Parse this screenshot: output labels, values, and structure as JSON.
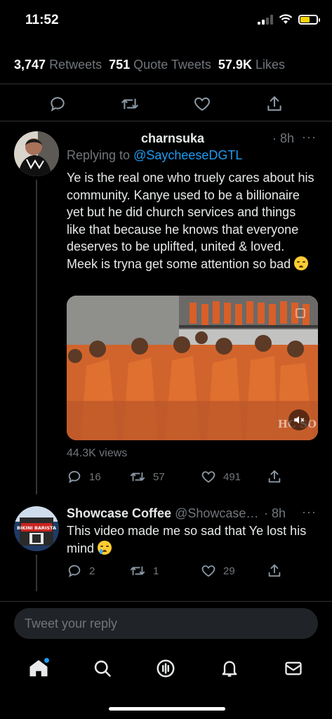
{
  "status_bar": {
    "time": "11:52"
  },
  "stats": {
    "retweets_count": "3,747",
    "retweets_label": "Retweets",
    "quotes_count": "751",
    "quotes_label": "Quote Tweets",
    "likes_count": "57.9K",
    "likes_label": "Likes"
  },
  "replies": [
    {
      "name": "charnsuka",
      "time": "· 8h",
      "more": "···",
      "replying_prefix": "Replying to ",
      "replying_handle": "@SaycheeseDGTL",
      "text": "Ye is the real one who truely cares about his community. Kanye used to be a billionaire yet but he did church services and things like that because he knows that everyone deserves to be uplifted, united & loved. Meek is tryna get some attention so bad",
      "media_watermark": "HC SO",
      "views": "44.3K views",
      "replies": "16",
      "retweets": "57",
      "likes": "491"
    },
    {
      "name": "Showcase Coffee",
      "handle": "@Showcase…",
      "time": "· 8h",
      "more": "···",
      "avatar_text": "BIKINI BARISTA",
      "text": "This video made me so sad that Ye lost his mind",
      "replies": "2",
      "retweets": "1",
      "likes": "29"
    }
  ],
  "compose": {
    "placeholder": "Tweet your reply"
  },
  "colors": {
    "accent": "#1d9bf0",
    "muted": "#71767b",
    "background": "#000000"
  },
  "icons": [
    "reply-icon",
    "retweet-icon",
    "like-icon",
    "share-icon",
    "home-icon",
    "search-icon",
    "spaces-icon",
    "notifications-icon",
    "messages-icon"
  ]
}
